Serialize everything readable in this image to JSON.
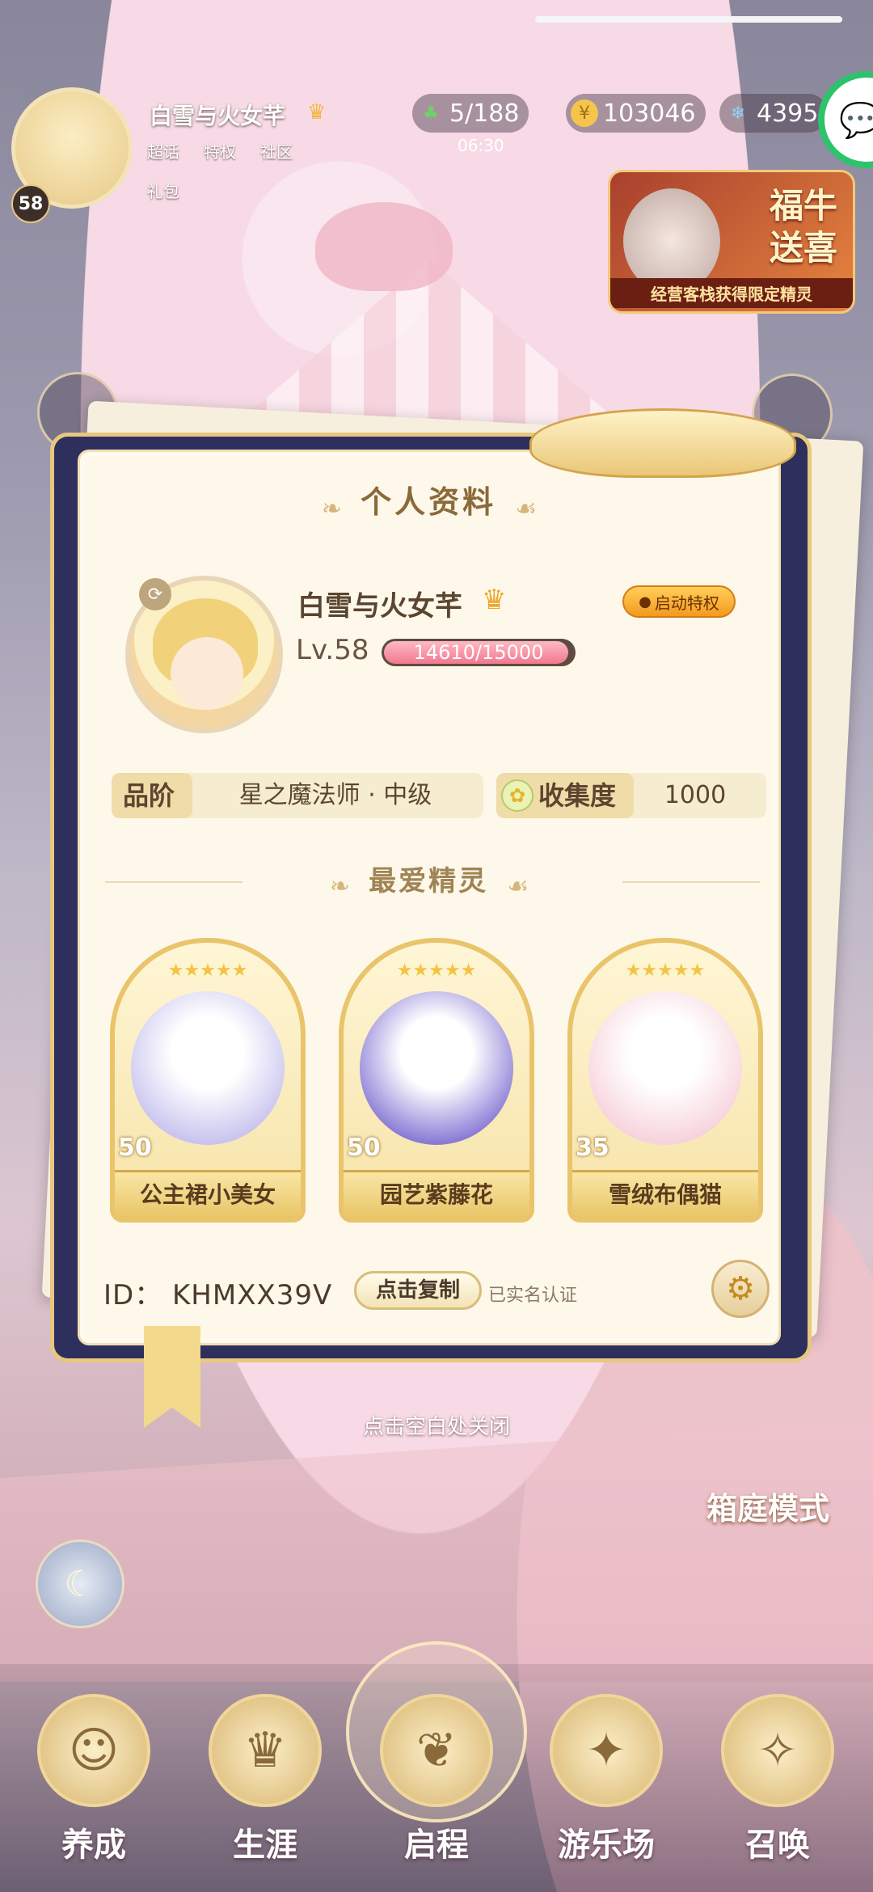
{
  "hud": {
    "player_name": "白雪与火女芊",
    "level_badge": "58",
    "links": [
      "超话",
      "特权",
      "社区",
      "礼包"
    ],
    "currencies": {
      "clover": "5/188",
      "clover_sub": "06:30",
      "coins": "103046",
      "gems": "4395"
    },
    "promo": {
      "title": "福牛送喜",
      "subtitle": "经营客栈获得限定精灵"
    }
  },
  "profile": {
    "title": "个人资料",
    "name": "白雪与火女芊",
    "privilege_button": "启动特权",
    "level": "Lv.58",
    "xp_text": "14610/15000",
    "xp_progress": 0.974,
    "rank_label": "品阶",
    "rank_value": "星之魔法师 · 中级",
    "collection_label": "收集度",
    "collection_value": "1000",
    "favorites_title": "最爱精灵",
    "favorites": [
      {
        "name": "公主裙小美女",
        "level": "50",
        "stars": "★★★★★",
        "color": "#c9c4ef"
      },
      {
        "name": "园艺紫藤花",
        "level": "50",
        "stars": "★★★★★",
        "color": "#8a7bd6"
      },
      {
        "name": "雪绒布偶猫",
        "level": "35",
        "stars": "★★★★★",
        "color": "#f7d3dc"
      }
    ],
    "id_text": "ID：  KHMXX39V",
    "copy_button": "点击复制",
    "verified_text": "已实名认证"
  },
  "close_hint": "点击空白处关闭",
  "garden_mode": "箱庭模式",
  "nav": {
    "items": [
      "养成",
      "生涯",
      "启程",
      "游乐场",
      "召唤"
    ]
  },
  "colors": {
    "accent_gold": "#e8c77f",
    "panel_bg": "#fdf8ea",
    "xp_pink": "#f0788f"
  }
}
